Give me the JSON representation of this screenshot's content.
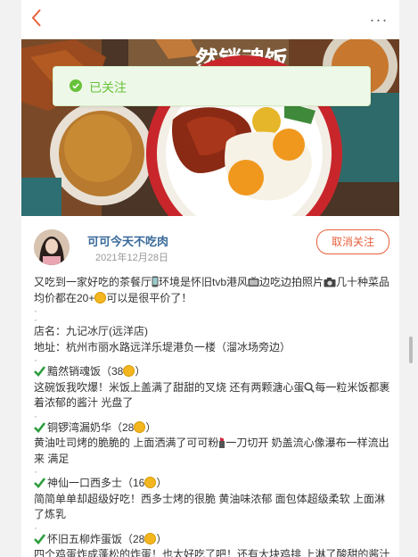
{
  "toast": {
    "text": "已关注"
  },
  "author": {
    "name": "可可今天不吃肉",
    "date": "2021年12月28日",
    "unfollow_label": "取消关注"
  },
  "post": {
    "intro": [
      "又吃到一家好吃的茶餐厅",
      "环境是怀旧tvb港风",
      "边吃边拍照片",
      "几十种菜品均价都在20+",
      "可以是很平价了！"
    ],
    "dot": "·",
    "shop_name": "店名：九记冰厅(远洋店)",
    "address": "地址：杭州市丽水路远洋乐堤港负一楼（溜冰场旁边）",
    "dishes": [
      {
        "title": "黯然销魂饭（38",
        "close": "）",
        "desc_a": "这碗饭我吹爆！米饭上盖满了甜甜的叉烧 还有两颗溏心蛋",
        "desc_b": "每一粒米饭都裹着浓郁的酱汁 光盘了"
      },
      {
        "title": "铜锣湾漏奶华（28",
        "close": "）",
        "desc_a": "黄油吐司烤的脆脆的 上面洒满了可可粉",
        "desc_b": "一刀切开 奶盖流心像瀑布一样流出来 满足"
      },
      {
        "title": "神仙一口西多士（16",
        "close": "）",
        "desc": "简简单单却超级好吃！西多士烤的很脆 黄油味浓郁 面包体超级柔软 上面淋了炼乳"
      },
      {
        "title": "怀旧五柳炸蛋饭（28",
        "close": "）",
        "desc": "四个鸡蛋炸成蓬松的炸蛋！也太好吃了吧！还有大块鸡排 上淋了酸甜的酱汁 太合我胃口了！！"
      }
    ]
  },
  "colors": {
    "accent": "#e8603c",
    "toast_green": "#67c23a",
    "check_green": "#2e9e3e",
    "coin": "#f3b61f"
  }
}
